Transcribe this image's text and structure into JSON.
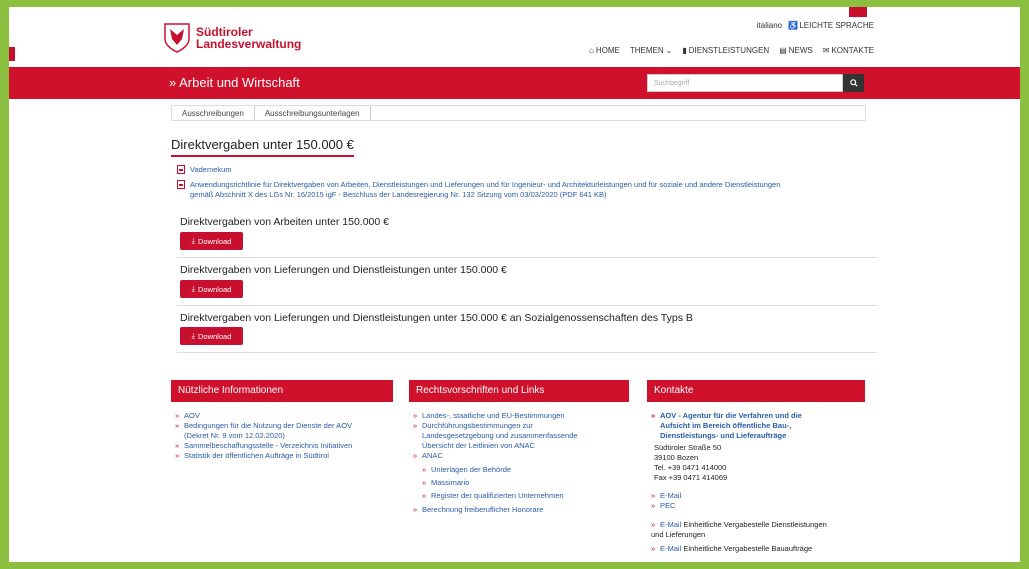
{
  "header": {
    "logo_line1": "Südtiroler",
    "logo_line2": "Landesverwaltung",
    "lang_italiano": "italiano",
    "lang_easy": "LEICHTE SPRACHE",
    "nav": [
      {
        "label": "HOME",
        "icon": "home-icon"
      },
      {
        "label": "THEMEN",
        "icon": "chevron-down-icon"
      },
      {
        "label": "DIENSTLEISTUNGEN",
        "icon": "bookmark-icon"
      },
      {
        "label": "NEWS",
        "icon": "newspaper-icon"
      },
      {
        "label": "KONTAKTE",
        "icon": "mail-icon"
      }
    ]
  },
  "redbar": {
    "title": "» Arbeit und Wirtschaft",
    "search_placeholder": "Suchbegriff"
  },
  "breadcrumb": [
    "Ausschreibungen",
    "Ausschreibungsunterlagen"
  ],
  "main": {
    "title": "Direktvergaben unter 150.000 €",
    "doc1": "Vademekum",
    "doc2_line1": "Anwendungsrichtlinie für Direktvergaben von Arbeiten, Dienstleistungen und Lieferungen und für Ingenieur- und Architekturleistungen und für soziale und andere Dienstleistungen",
    "doc2_line2": "gemäß Abschnitt X des LGs Nr. 16/2015 igF - Beschluss der Landesregierung Nr. 132 Sitzung vom 03/03/2020 (PDF 641 KB)",
    "sections": [
      {
        "title": "Direktvergaben von Arbeiten unter 150.000 €",
        "button": "Download"
      },
      {
        "title": "Direktvergaben von Lieferungen und Dienstleistungen unter 150.000 €",
        "button": "Download"
      },
      {
        "title": "Direktvergaben von Lieferungen und Dienstleistungen unter 150.000 € an Sozialgenossenschaften des Typs B",
        "button": "Download"
      }
    ]
  },
  "footer": {
    "info": {
      "title": "Nützliche Informationen",
      "items": [
        "AOV",
        "Bedingungen für die Nutzung der Dienste der AOV",
        "(Dekret Nr. 9 vom 12.02.2020)",
        "Sammelbeschaffungsstelle - Verzeichnis Initiativen",
        "Statistik der öffentlichen Aufträge in Südtirol"
      ]
    },
    "law": {
      "title": "Rechtsvorschriften und Links",
      "items": [
        "Landes-, staatliche und EU-Bestimmungen",
        "Durchführungsbestimmungen zur",
        "Landesgesetzgebung und zusammenfassende",
        "Übersicht der Leitlinien von ANAC",
        "ANAC",
        "Unterlagen der Behörde",
        "Massimario",
        "Register der qualifizierten Unternehmen",
        "Berechnung freiberuflicher Honorare"
      ]
    },
    "contact": {
      "title": "Kontakte",
      "org1": "AOV - Agentur für die Verfahren und die",
      "org2": "Aufsicht im Bereich öffentliche Bau-,",
      "org3": "Dienstleistungs- und Lieferaufträge",
      "street": "Südtiroler Straße 50",
      "city": "39100 Bozen",
      "tel": "Tel. +39 0471 414000",
      "fax": "Fax +39 0471 414069",
      "email": "E-Mail",
      "pec": "PEC",
      "email2_link": "E-Mail",
      "email2_text": "Einheitliche Vergabestelle Dienstleistungen",
      "email2_text2": "und Lieferungen",
      "email3_link": "E-Mail",
      "email3_text": "Einheitliche Vergabestelle Bauaufträge"
    }
  },
  "colors": {
    "brand_red": "#d0112b",
    "link_blue": "#2a5caa",
    "frame_green": "#8cbf3f"
  }
}
